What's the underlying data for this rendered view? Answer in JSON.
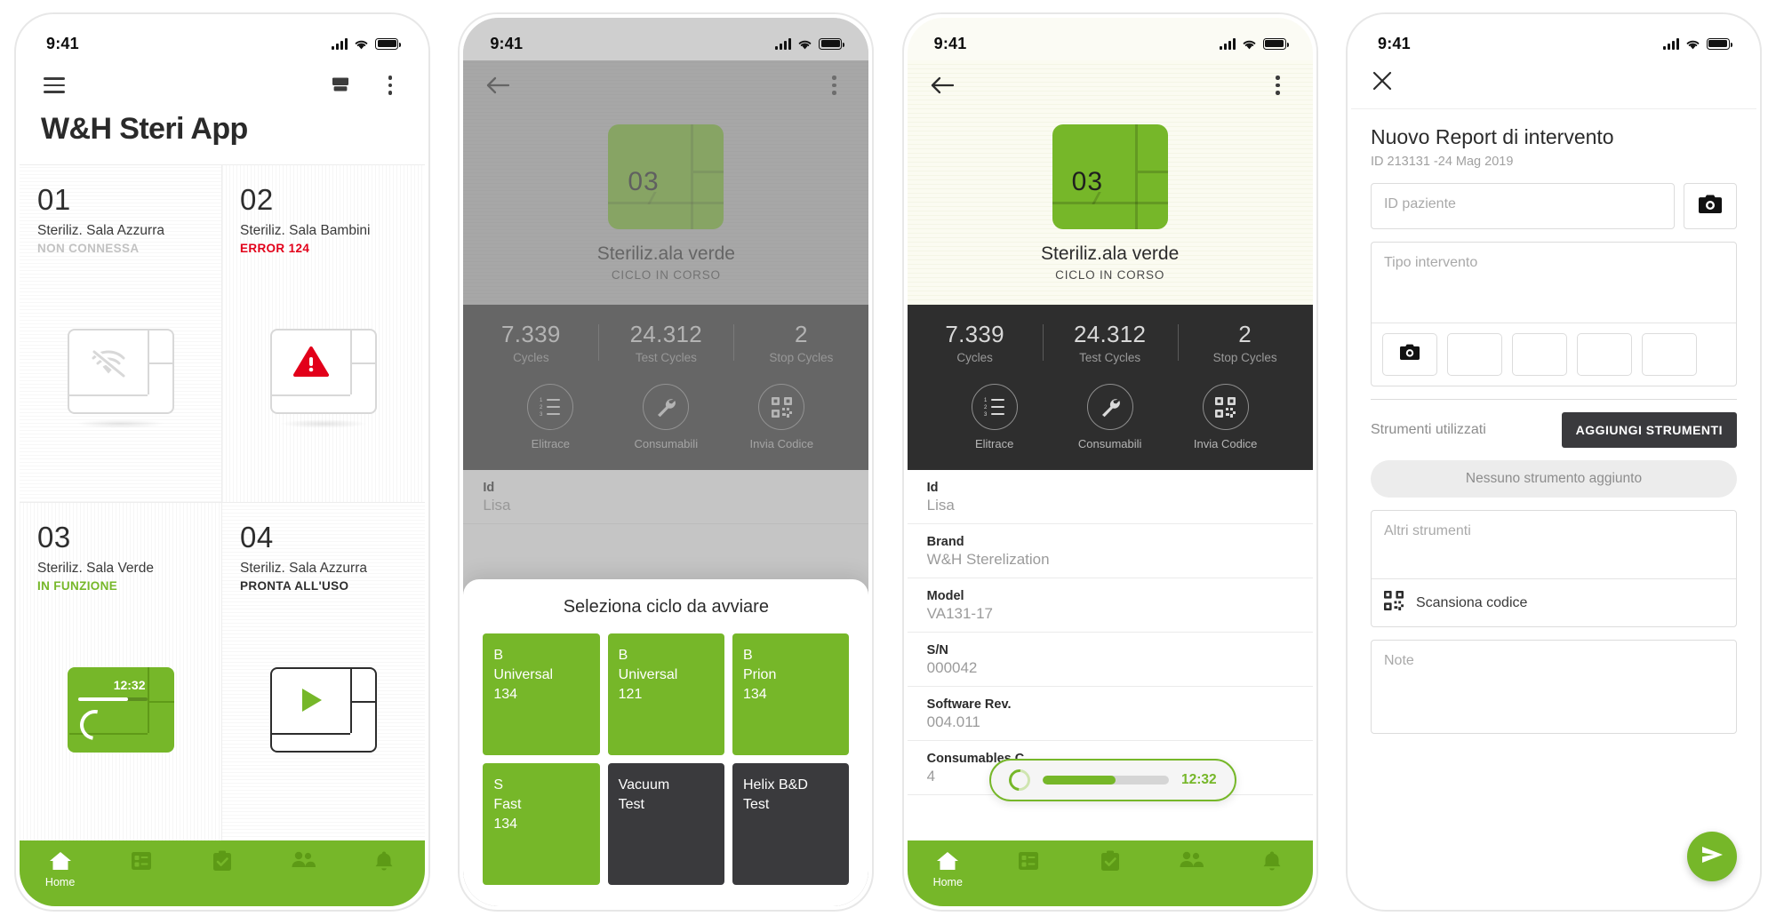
{
  "status_bar": {
    "time": "9:41",
    "signal_icon": "cellular-signal-icon",
    "wifi_icon": "wifi-icon",
    "battery_icon": "battery-full-icon"
  },
  "colors": {
    "brand_green": "#76b729",
    "dark_green": "#5f9a18",
    "error_red": "#e2001a",
    "dark_panel": "#2e2e2e",
    "card_dark": "#3a3a3d"
  },
  "phone1": {
    "toolbar": {
      "menu_icon": "hamburger-menu-icon",
      "archive_icon": "archive-inbox-icon",
      "overflow_icon": "overflow-menu-icon"
    },
    "title": "W&H Steri App",
    "tiles": [
      {
        "number": "01",
        "name": "Steriliz. Sala Azzurra",
        "state": "NON CONNESSA",
        "state_kind": "offline",
        "art": "sterilizer-offline"
      },
      {
        "number": "02",
        "name": "Steriliz. Sala Bambini",
        "state": "ERROR 124",
        "state_kind": "error",
        "art": "sterilizer-error"
      },
      {
        "number": "03",
        "name": "Steriliz. Sala Verde",
        "state": "IN FUNZIONE",
        "state_kind": "running",
        "art": "sterilizer-running",
        "timer": "12:32"
      },
      {
        "number": "04",
        "name": "Steriliz. Sala Azzurra",
        "state": "PRONTA ALL'USO",
        "state_kind": "ready",
        "art": "sterilizer-ready"
      }
    ],
    "bottom_nav": [
      {
        "label": "Home",
        "icon": "home-icon",
        "active": true
      },
      {
        "label": "",
        "icon": "list-checklist-icon",
        "active": false
      },
      {
        "label": "",
        "icon": "clipboard-check-icon",
        "active": false
      },
      {
        "label": "",
        "icon": "people-group-icon",
        "active": false
      },
      {
        "label": "",
        "icon": "bell-notification-icon",
        "active": false
      }
    ]
  },
  "phone2": {
    "toolbar": {
      "back_icon": "back-arrow-icon",
      "overflow_icon": "overflow-menu-icon"
    },
    "hero": {
      "number": "03",
      "name": "Steriliz.ala verde",
      "state": "CICLO IN CORSO"
    },
    "stats": [
      {
        "value": "7.339",
        "label": "Cycles"
      },
      {
        "value": "24.312",
        "label": "Test Cycles"
      },
      {
        "value": "2",
        "label": "Stop Cycles"
      }
    ],
    "actions": [
      {
        "label": "Elitrace",
        "icon": "numbered-list-icon"
      },
      {
        "label": "Consumabili",
        "icon": "wrench-icon"
      },
      {
        "label": "Invia Codice",
        "icon": "qr-code-icon"
      }
    ],
    "specs": [
      {
        "key": "Id",
        "value": "Lisa"
      }
    ],
    "sheet": {
      "title": "Seleziona ciclo da avviare",
      "cycles": [
        {
          "lines": [
            "B",
            "Universal",
            "134"
          ],
          "style": "green"
        },
        {
          "lines": [
            "B",
            "Universal",
            "121"
          ],
          "style": "green"
        },
        {
          "lines": [
            "B",
            "Prion",
            "134"
          ],
          "style": "green"
        },
        {
          "lines": [
            "S",
            "Fast",
            "134"
          ],
          "style": "green"
        },
        {
          "lines": [
            "Vacuum",
            "Test"
          ],
          "style": "dark"
        },
        {
          "lines": [
            "Helix B&D",
            "Test"
          ],
          "style": "dark"
        }
      ]
    }
  },
  "phone3": {
    "toolbar": {
      "back_icon": "back-arrow-icon",
      "overflow_icon": "overflow-menu-icon"
    },
    "hero": {
      "number": "03",
      "name": "Steriliz.ala verde",
      "state": "CICLO IN CORSO"
    },
    "stats": [
      {
        "value": "7.339",
        "label": "Cycles"
      },
      {
        "value": "24.312",
        "label": "Test Cycles"
      },
      {
        "value": "2",
        "label": "Stop Cycles"
      }
    ],
    "actions": [
      {
        "label": "Elitrace",
        "icon": "numbered-list-icon"
      },
      {
        "label": "Consumabili",
        "icon": "wrench-icon"
      },
      {
        "label": "Invia Codice",
        "icon": "qr-code-icon"
      }
    ],
    "specs": [
      {
        "key": "Id",
        "value": "Lisa"
      },
      {
        "key": "Brand",
        "value": "W&H Sterelization"
      },
      {
        "key": "Model",
        "value": "VA131-17"
      },
      {
        "key": "S/N",
        "value": "000042"
      },
      {
        "key": "Software Rev.",
        "value": "004.011"
      },
      {
        "key": "Consumables C",
        "value": "4"
      }
    ],
    "toast": {
      "time": "12:32",
      "progress_percent": 58,
      "spinner_icon": "loading-spinner-icon"
    },
    "bottom_nav": [
      {
        "label": "Home",
        "icon": "home-icon",
        "active": true
      },
      {
        "label": "",
        "icon": "list-checklist-icon",
        "active": false
      },
      {
        "label": "",
        "icon": "clipboard-check-icon",
        "active": false
      },
      {
        "label": "",
        "icon": "people-group-icon",
        "active": false
      },
      {
        "label": "",
        "icon": "bell-notification-icon",
        "active": false
      }
    ]
  },
  "phone4": {
    "toolbar": {
      "close_icon": "close-x-icon"
    },
    "title": "Nuovo Report di intervento",
    "subtitle": "ID 213131 -24 Mag 2019",
    "patient_id_placeholder": "ID paziente",
    "patient_camera_icon": "camera-icon",
    "intervention_placeholder": "Tipo intervento",
    "thumb_camera_icon": "camera-icon",
    "thumbnails_count": 5,
    "tools_label": "Strumenti utilizzati",
    "add_tools_button": "AGGIUNGI STRUMENTI",
    "no_tools_pill": "Nessuno strumento aggiunto",
    "other_tools_placeholder": "Altri strumenti",
    "scan_label": "Scansiona codice",
    "scan_icon": "qr-code-icon",
    "note_placeholder": "Note",
    "send_icon": "send-paper-plane-icon"
  }
}
